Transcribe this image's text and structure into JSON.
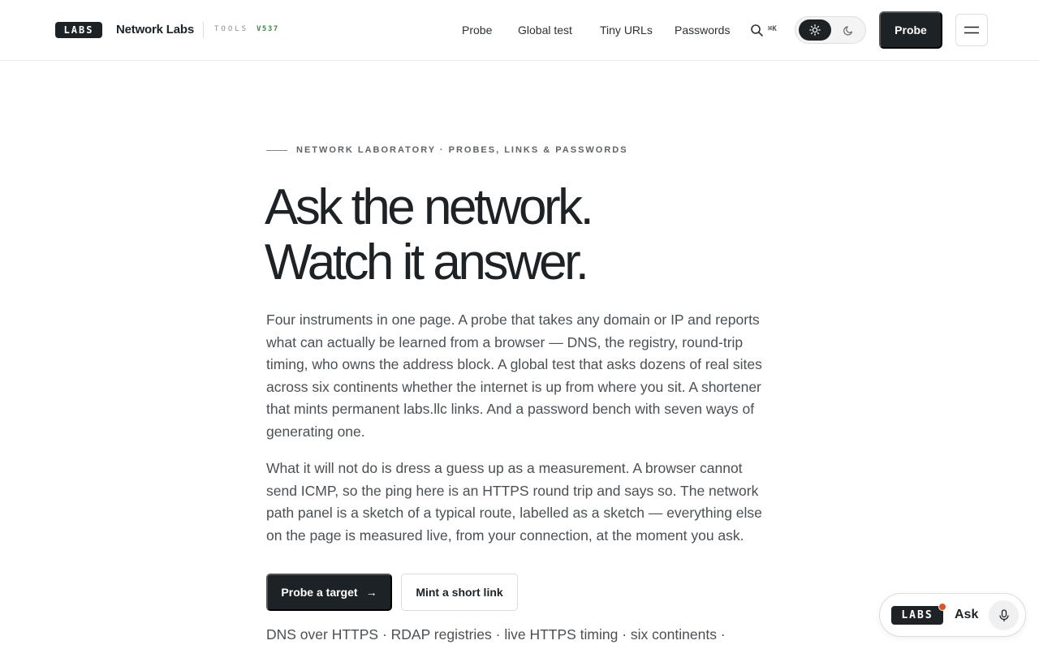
{
  "header": {
    "logo_text": "LABS",
    "brand_name": "Network Labs",
    "tools_label": "TOOLS",
    "version": "V537",
    "nav": [
      "Probe",
      "Global test",
      "Tiny URLs",
      "Passwords"
    ],
    "search_shortcut": "⌘K",
    "theme_options": [
      "light",
      "dark"
    ],
    "theme_selected": "light",
    "probe_button": "Probe"
  },
  "hero": {
    "eyebrow": "NETWORK LABORATORY · PROBES, LINKS & PASSWORDS",
    "headline_line1": "Ask the network.",
    "headline_line2": "Watch it answer.",
    "paragraph1": "Four instruments in one page. A probe that takes any domain or IP and reports what can actually be learned from a browser — DNS, the registry, round-trip timing, who owns the address block. A global test that asks dozens of real sites across six continents whether the internet is up from where you sit. A shortener that mints permanent labs.llc links. And a password bench with seven ways of generating one.",
    "paragraph2": "What it will not do is dress a guess up as a measurement. A browser cannot send ICMP, so the ping here is an HTTPS round trip and says so. The network path panel is a sketch of a typical route, labelled as a sketch — everything else on the page is measured live, from your connection, at the moment you ask.",
    "cta_primary": "Probe a target",
    "cta_primary_arrow": "→",
    "cta_secondary": "Mint a short link",
    "features": "DNS over HTTPS · RDAP registries · live HTTPS timing · six continents ·"
  },
  "ask_widget": {
    "logo_text": "LABS",
    "label": "Ask"
  },
  "colors": {
    "ink": "#1c2226",
    "accent_line": "#b8763a",
    "version_green": "#3a8a4a",
    "notification_dot": "#e0531f"
  }
}
